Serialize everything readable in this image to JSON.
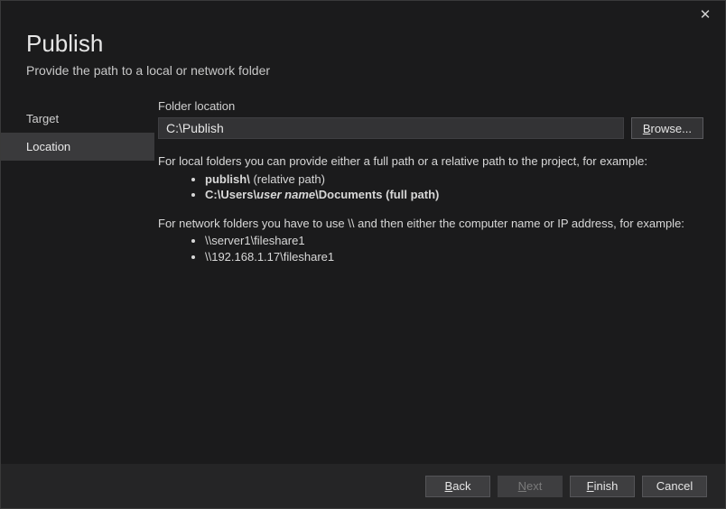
{
  "window": {
    "title": "Publish",
    "subtitle": "Provide the path to a local or network folder"
  },
  "sidebar": {
    "items": [
      {
        "label": "Target",
        "selected": false
      },
      {
        "label": "Location",
        "selected": true
      }
    ]
  },
  "main": {
    "folderLocationLabel": "Folder location",
    "folderLocationValue": "C:\\Publish",
    "browseLabel": "Browse...",
    "help": {
      "localIntro": "For local folders you can provide either a full path or a relative path to the project, for example:",
      "localExamples": {
        "relativePrefix": "publish\\ ",
        "relativeSuffix": "(relative path)",
        "fullPrefix": "C:\\Users\\",
        "fullUser": "user name",
        "fullSuffix": "\\Documents (full path)"
      },
      "networkIntro": "For network folders you have to use \\\\ and then either the computer name or IP address, for example:",
      "networkExamples": [
        "\\\\server1\\fileshare1",
        "\\\\192.168.1.17\\fileshare1"
      ]
    }
  },
  "footer": {
    "backLabel": "Back",
    "nextLabel": "Next",
    "finishLabel": "Finish",
    "cancelLabel": "Cancel"
  },
  "colors": {
    "background": "#1b1b1c",
    "panel": "#252526",
    "inputBg": "#333335",
    "text": "#d0d0d0",
    "selectedBg": "#3a3a3c"
  }
}
